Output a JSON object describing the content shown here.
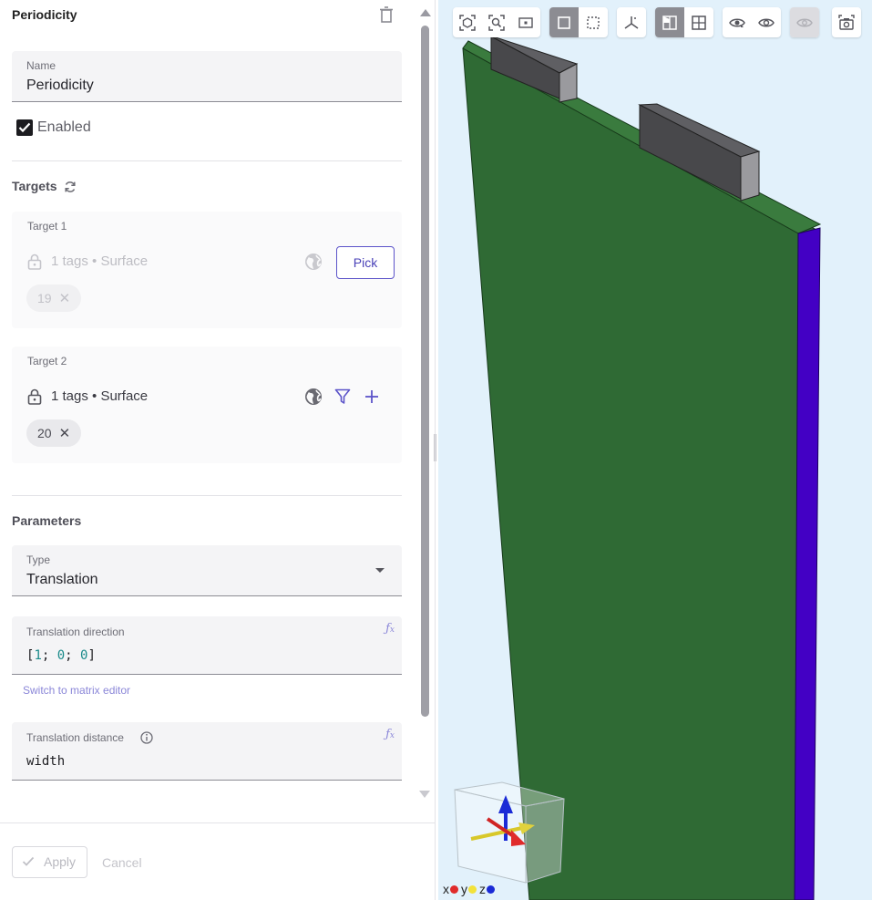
{
  "panel": {
    "title": "Periodicity",
    "name_field": {
      "label": "Name",
      "value": "Periodicity"
    },
    "enabled": {
      "label": "Enabled",
      "checked": true
    },
    "targets": {
      "heading": "Targets",
      "items": [
        {
          "label": "Target 1",
          "tags_text": "1 tags • Surface",
          "chip": "19",
          "pick_label": "Pick",
          "disabled": true
        },
        {
          "label": "Target 2",
          "tags_text": "1 tags • Surface",
          "chip": "20",
          "disabled": false
        }
      ]
    },
    "parameters": {
      "heading": "Parameters",
      "type_field": {
        "label": "Type",
        "value": "Translation"
      },
      "direction_field": {
        "label": "Translation direction",
        "values": [
          "1",
          "0",
          "0"
        ]
      },
      "switch_link": "Switch to matrix editor",
      "distance_field": {
        "label": "Translation distance",
        "value": "width"
      }
    },
    "footer": {
      "apply_label": "Apply",
      "cancel_label": "Cancel"
    }
  },
  "viewport": {
    "axis_legend": [
      {
        "label": "x",
        "color": "#e02b2b"
      },
      {
        "label": "y",
        "color": "#f2e23a"
      },
      {
        "label": "z",
        "color": "#1a2ad6"
      }
    ],
    "colors": {
      "board": "#2f6a34",
      "board_side": "#4300c4",
      "block": "#4a4a4d",
      "background": "#e2f1fb"
    }
  }
}
